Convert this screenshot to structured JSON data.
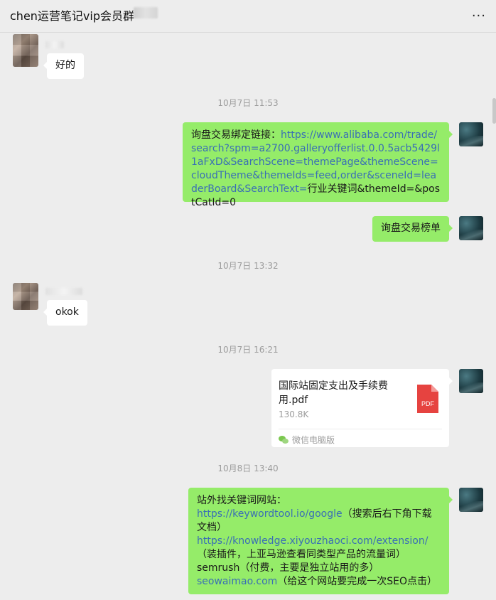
{
  "header": {
    "title": "chen运营笔记vip会员群",
    "more_icon": "more-icon",
    "more_glyph": "···"
  },
  "messages": {
    "m1_text": "好的",
    "t1": "10月7日 11:53",
    "m2_prefix": "询盘交易绑定链接：",
    "m2_link": "https://www.alibaba.com/trade/search?spm=a2700.galleryofferlist.0.0.5acb5429l1aFxD&SearchScene=themePage&themeScene=cloudTheme&themeIds=feed,order&sceneId=leaderBoard&SearchText=",
    "m2_suffix": "行业关键词&themeId=&postCatId=0",
    "m3_text": "询盘交易榜单",
    "t2": "10月7日 13:32",
    "m4_text": "okok",
    "t3": "10月7日 16:21",
    "file": {
      "name": "国际站固定支出及手续费用.pdf",
      "size": "130.8K",
      "badge": "PDF",
      "source": "微信电脑版",
      "source_icon": "wechat-icon"
    },
    "t4": "10月8日 13:40",
    "m5": {
      "line1": "站外找关键词网站：",
      "link1": "https://keywordtool.io/google",
      "note1": "（搜索后右下角下载文档）",
      "link2": "https://knowledge.xiyouzhaoci.com/extension/",
      "note2": "（装插件，上亚马逊查看同类型产品的流量词）",
      "line_semrush": "semrush（付费，主要是独立站用的多）",
      "link3": "seowaimao.com",
      "note3": "（给这个网站要完成一次SEO点击）"
    }
  },
  "colors": {
    "background": "#ededed",
    "self_bubble": "#95ec69",
    "other_bubble": "#ffffff",
    "link": "#3a6fb5",
    "timestamp": "#9c9c9c",
    "pdf_icon": "#e64340"
  }
}
